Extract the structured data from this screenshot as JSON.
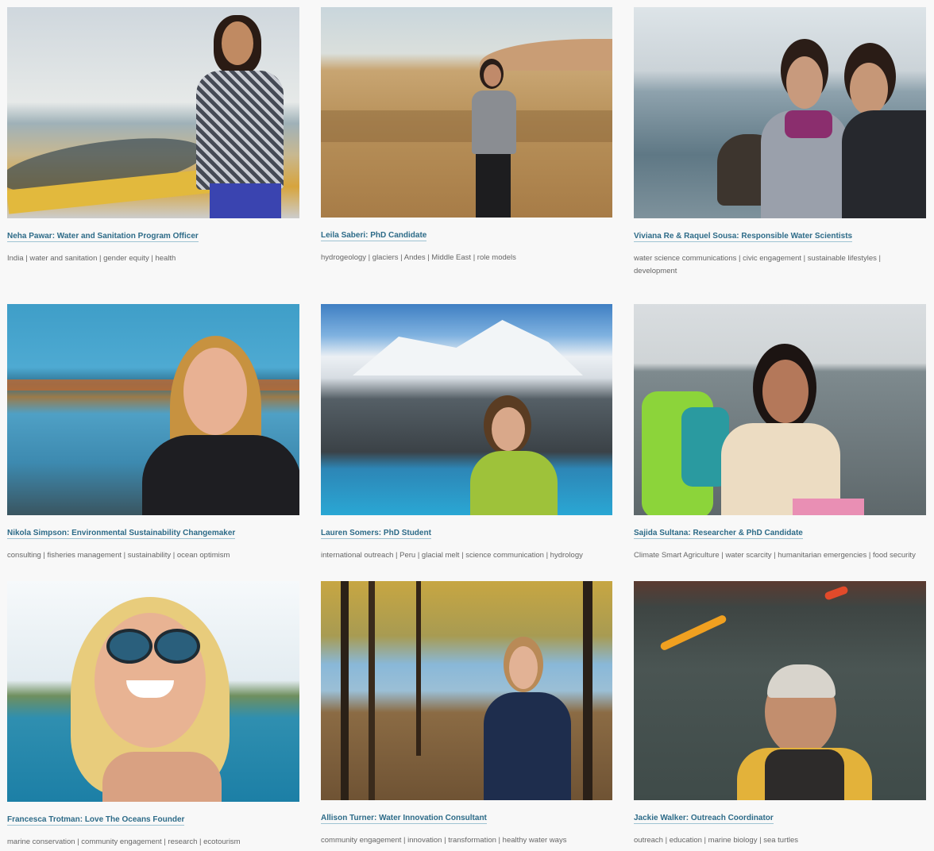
{
  "profiles": [
    {
      "title": "Neha Pawar: Water and Sanitation Program Officer",
      "tags": "India | water and sanitation | gender equity | health"
    },
    {
      "title": "Leila Saberi: PhD Candidate",
      "tags": "hydrogeology | glaciers | Andes | Middle East | role models"
    },
    {
      "title": "Viviana Re & Raquel Sousa: Responsible Water Scientists",
      "tags": "water science communications | civic engagement | sustainable lifestyles | development"
    },
    {
      "title": "Nikola Simpson: Environmental Sustainability Changemaker",
      "tags": "consulting | fisheries management | sustainability | ocean optimism"
    },
    {
      "title": "Lauren Somers: PhD Student",
      "tags": "international outreach | Peru | glacial melt | science communication | hydrology"
    },
    {
      "title": "Sajida Sultana: Researcher & PhD Candidate",
      "tags": "Climate Smart Agriculture | water scarcity | humanitarian emergencies | food security"
    },
    {
      "title": "Francesca Trotman: Love The Oceans Founder",
      "tags": "marine conservation | community engagement | research | ecotourism"
    },
    {
      "title": "Allison Turner: Water Innovation Consultant",
      "tags": "community engagement | innovation | transformation | healthy water ways"
    },
    {
      "title": "Jackie Walker: Outreach Coordinator",
      "tags": "outreach | education | marine biology | sea turtles"
    }
  ]
}
